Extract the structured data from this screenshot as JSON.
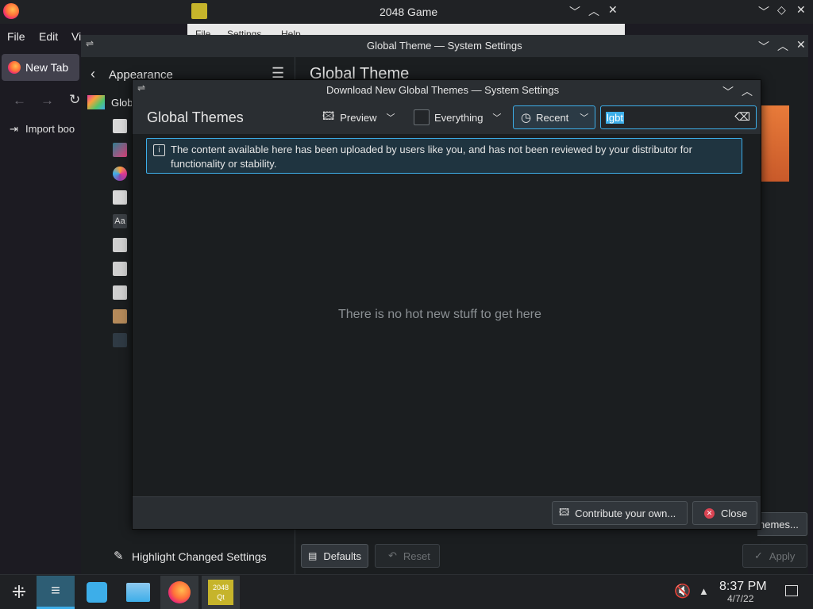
{
  "firefox": {
    "menu": [
      "File",
      "Edit",
      "Vi"
    ],
    "tab_label": "New Tab",
    "bookmark_label": "Import boo"
  },
  "game": {
    "title": "2048 Game",
    "menu": [
      "File",
      "Settings",
      "Help"
    ]
  },
  "settings": {
    "title": "Global Theme — System Settings",
    "back_label": "Appearance",
    "page_title": "Global Theme",
    "sidebar_first": "Glob",
    "highlight_label": "Highlight Changed Settings",
    "defaults_label": "Defaults",
    "reset_label": "Reset",
    "apply_label": "Apply",
    "get_new_label": "hemes..."
  },
  "dialog": {
    "title": "Download New Global Themes — System Settings",
    "heading": "Global Themes",
    "view_label": "Preview",
    "filter_label": "Everything",
    "sort_label": "Recent",
    "search_value": "lgbt",
    "notice": "The content available here has been uploaded by users like you, and has not been reviewed by your distributor for functionality or stability.",
    "empty_message": "There is no hot new stuff to get here",
    "contribute_label": "Contribute your own...",
    "close_label": "Close"
  },
  "taskbar": {
    "time": "8:37 PM",
    "date": "4/7/22",
    "game_tile_top": "2048",
    "game_tile_bottom": "Qt"
  },
  "colors": {
    "accent": "#3daee9",
    "close_red": "#da4453",
    "selection": "#3daee9"
  }
}
